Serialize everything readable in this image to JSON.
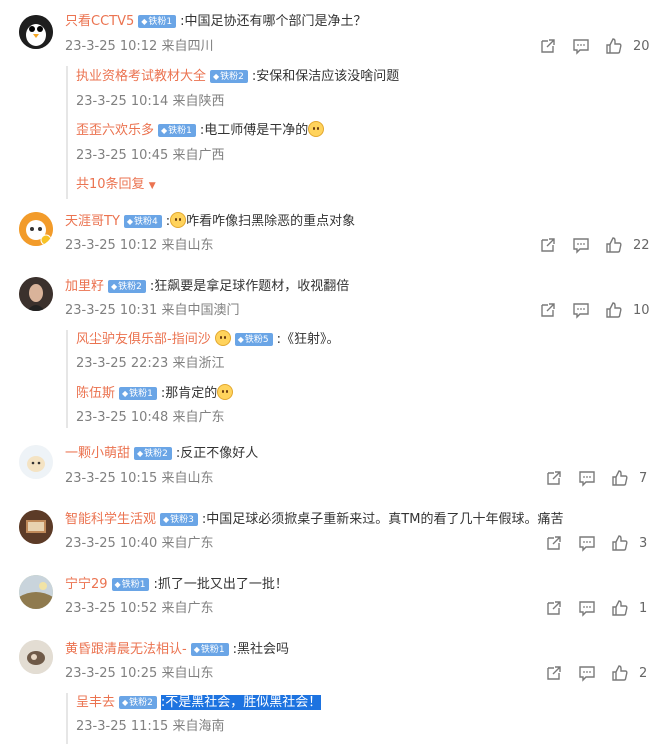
{
  "c1": {
    "user": "只看CCTV5",
    "badge": "铁粉1",
    "text": ":中国足协还有哪个部门是净土？",
    "time": "23-3-25 10:12 来自四川",
    "likes": "20"
  },
  "c1r1": {
    "user": "执业资格考试教材大全",
    "badge": "铁粉2",
    "text": ":安保和保洁应该没啥问题",
    "time": "23-3-25 10:14 来自陕西"
  },
  "c1r2": {
    "user": "歪歪六欢乐多",
    "badge": "铁粉1",
    "text": ":电工师傅是干净的",
    "time": "23-3-25 10:45 来自广西"
  },
  "c1more": "共10条回复",
  "c2": {
    "user": "天涯哥TY",
    "badge": "铁粉4",
    "text": "咋看咋像扫黑除恶的重点对象",
    "time": "23-3-25 10:12 来自山东",
    "likes": "22"
  },
  "c3": {
    "user": "加里籽",
    "badge": "铁粉2",
    "text": ":狂飙要是拿足球作题材，收视翻倍",
    "time": "23-3-25 10:31 来自中国澳门",
    "likes": "10"
  },
  "c3r1": {
    "user": "风尘驴友俱乐部-指间沙",
    "badge": "铁粉5",
    "text": ":《狂射》。",
    "time": "23-3-25 22:23 来自浙江"
  },
  "c3r2": {
    "user": "陈伍斯",
    "badge": "铁粉1",
    "text": ":那肯定的",
    "time": "23-3-25 10:48 来自广东"
  },
  "c4": {
    "user": "一颗小萌甜",
    "badge": "铁粉2",
    "text": ":反正不像好人",
    "time": "23-3-25 10:15 来自山东",
    "likes": "7"
  },
  "c5": {
    "user": "智能科学生活观",
    "badge": "铁粉3",
    "text": ":中国足球必须掀桌子重新来过。真TM的看了几十年假球。痛苦",
    "time": "23-3-25 10:40 来自广东",
    "likes": "3"
  },
  "c6": {
    "user": "宁宁29",
    "badge": "铁粉1",
    "text": ":抓了一批又出了一批！",
    "time": "23-3-25 10:52 来自广东",
    "likes": "1"
  },
  "c7": {
    "user": "黄昏跟清晨无法相认-",
    "badge": "铁粉1",
    "text": ":黑社会吗",
    "time": "23-3-25 10:25 来自山东",
    "likes": "2"
  },
  "c7r1": {
    "user": "呈丰去",
    "badge": "铁粉2",
    "text": ":不是黑社会，胜似黑社会！",
    "time": "23-3-25 11:15 来自海南"
  },
  "colors": {
    "username": "#eb7350",
    "badge": "#6aa5e6",
    "meta": "#808080",
    "highlight": "#1d73e0"
  },
  "icons": [
    "share-icon",
    "comment-icon",
    "like-icon"
  ]
}
